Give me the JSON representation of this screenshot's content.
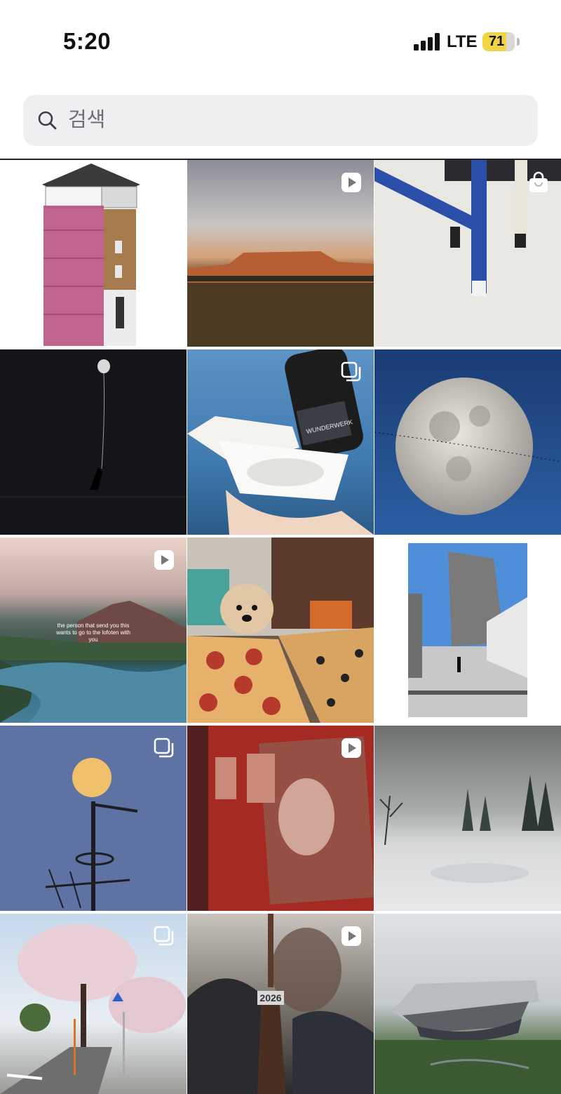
{
  "status_bar": {
    "time": "5:20",
    "network": "LTE",
    "battery": "71"
  },
  "search": {
    "placeholder": "검색"
  },
  "grid": {
    "tiles": [
      {
        "subject": "scaffolded-building",
        "badge": "carousel-icon"
      },
      {
        "subject": "desert-mesa",
        "badge": "reel-icon"
      },
      {
        "subject": "blue-chair-leg",
        "badge": "shopping-bag-icon"
      },
      {
        "subject": "balloon-night",
        "badge": ""
      },
      {
        "subject": "food-and-wine",
        "badge": "carousel-icon",
        "text": "WUNDERWERK"
      },
      {
        "subject": "full-moon",
        "badge": ""
      },
      {
        "subject": "lofoten-coast",
        "badge": "reel-icon",
        "text": "the person that send you this wants to go to the lofoten with you"
      },
      {
        "subject": "dog-and-pizza",
        "badge": ""
      },
      {
        "subject": "modern-tower",
        "badge": "carousel-icon"
      },
      {
        "subject": "moon-antenna",
        "badge": "carousel-icon"
      },
      {
        "subject": "red-jersey",
        "badge": "reel-icon"
      },
      {
        "subject": "snowy-forest",
        "badge": ""
      },
      {
        "subject": "cherry-blossom-street",
        "badge": "carousel-icon"
      },
      {
        "subject": "graduation-tassel",
        "badge": "reel-icon",
        "text": "2026"
      },
      {
        "subject": "futuristic-stadium",
        "badge": ""
      }
    ]
  }
}
